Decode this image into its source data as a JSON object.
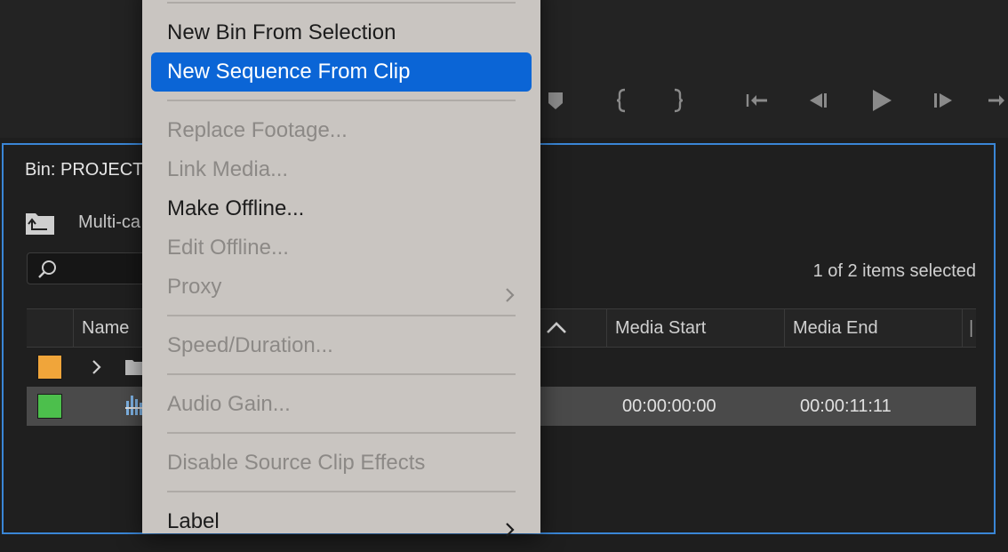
{
  "bin": {
    "title": "Bin: PROJECT",
    "path": "Multi-ca",
    "items_count": "1 of 2 items selected",
    "search_placeholder": ""
  },
  "table": {
    "columns": [
      "Name",
      "Media Start",
      "Media End"
    ],
    "rows": [
      {
        "type": "folder",
        "label_color": "#f0a53a",
        "media_start": "",
        "media_end": ""
      },
      {
        "type": "clip",
        "label_color": "#4cbf4c",
        "media_start": "00:00:00:00",
        "media_end": "00:00:11:11",
        "selected": true
      }
    ]
  },
  "transport": {
    "icons": [
      "marker-icon",
      "mark-in-icon",
      "mark-out-icon",
      "go-to-in-icon",
      "step-back-icon",
      "play-icon",
      "step-forward-icon",
      "go-to-out-icon"
    ]
  },
  "context_menu": {
    "items": [
      {
        "label": "New Bin From Selection",
        "enabled": true
      },
      {
        "label": "New Sequence From Clip",
        "enabled": true,
        "highlighted": true
      },
      {
        "label": "Replace Footage...",
        "enabled": false
      },
      {
        "label": "Link Media...",
        "enabled": false
      },
      {
        "label": "Make Offline...",
        "enabled": true
      },
      {
        "label": "Edit Offline...",
        "enabled": false
      },
      {
        "label": "Proxy",
        "enabled": false,
        "submenu": true
      },
      {
        "label": "Speed/Duration...",
        "enabled": false
      },
      {
        "label": "Audio Gain...",
        "enabled": false
      },
      {
        "label": "Disable Source Clip Effects",
        "enabled": false
      },
      {
        "label": "Label",
        "enabled": true,
        "submenu": true
      }
    ]
  },
  "colors": {
    "accent": "#0b65d6",
    "panel_focus_border": "#3a86d6",
    "menu_background": "#c9c5c1"
  }
}
